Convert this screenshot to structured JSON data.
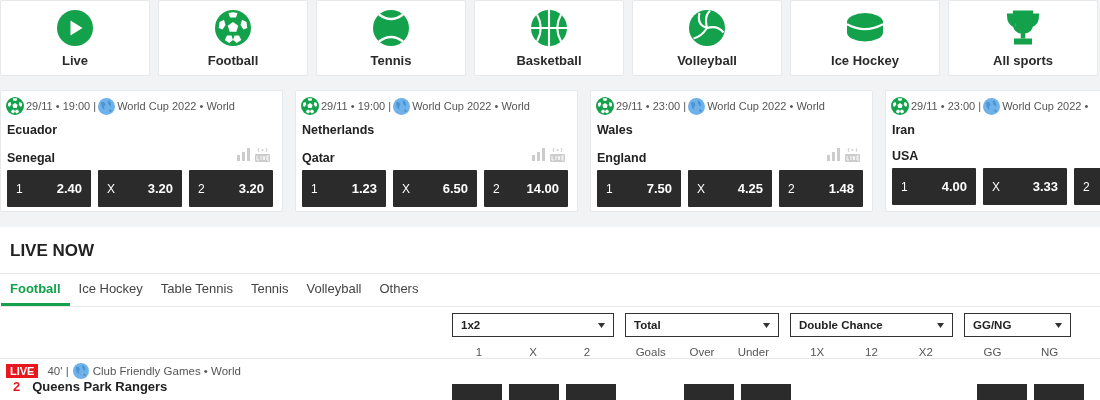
{
  "sports": [
    {
      "label": "Live",
      "kind": "live"
    },
    {
      "label": "Football",
      "kind": "football"
    },
    {
      "label": "Tennis",
      "kind": "tennis"
    },
    {
      "label": "Basketball",
      "kind": "basketball"
    },
    {
      "label": "Volleyball",
      "kind": "volleyball"
    },
    {
      "label": "Ice Hockey",
      "kind": "hockey"
    },
    {
      "label": "All sports",
      "kind": "trophy"
    }
  ],
  "matches": [
    {
      "kind": "football",
      "datetime": "29/11 • 19:00 |",
      "league": "World Cup 2022 • World",
      "home": "Ecuador",
      "away": "Senegal",
      "stats": true,
      "odds": [
        {
          "label": "1",
          "value": "2.40"
        },
        {
          "label": "X",
          "value": "3.20"
        },
        {
          "label": "2",
          "value": "3.20"
        }
      ]
    },
    {
      "kind": "football",
      "datetime": "29/11 • 19:00 |",
      "league": "World Cup 2022 • World",
      "home": "Netherlands",
      "away": "Qatar",
      "stats": true,
      "odds": [
        {
          "label": "1",
          "value": "1.23"
        },
        {
          "label": "X",
          "value": "6.50"
        },
        {
          "label": "2",
          "value": "14.00"
        }
      ]
    },
    {
      "kind": "football",
      "datetime": "29/11 • 23:00 |",
      "league": "World Cup 2022 • World",
      "home": "Wales",
      "away": "England",
      "stats": true,
      "odds": [
        {
          "label": "1",
          "value": "7.50"
        },
        {
          "label": "X",
          "value": "4.25"
        },
        {
          "label": "2",
          "value": "1.48"
        }
      ]
    },
    {
      "kind": "football",
      "datetime": "29/11 • 23:00 |",
      "league": "World Cup 2022 •",
      "home": "Iran",
      "away": "USA",
      "stats": false,
      "odds": [
        {
          "label": "1",
          "value": "4.00"
        },
        {
          "label": "X",
          "value": "3.33"
        },
        {
          "label": "2"
        }
      ]
    }
  ],
  "live": {
    "title": "LIVE NOW",
    "tabs": [
      {
        "label": "Football",
        "selected": true
      },
      {
        "label": "Ice Hockey",
        "selected": false
      },
      {
        "label": "Table Tennis",
        "selected": false
      },
      {
        "label": "Tennis",
        "selected": false
      },
      {
        "label": "Volleyball",
        "selected": false
      },
      {
        "label": "Others",
        "selected": false
      }
    ],
    "markets": [
      {
        "name": "1x2",
        "columns": [
          "1",
          "X",
          "2"
        ]
      },
      {
        "name": "Total",
        "columns": [
          "Goals",
          "Over",
          "Under"
        ]
      },
      {
        "name": "Double Chance",
        "columns": [
          "1X",
          "12",
          "X2"
        ]
      },
      {
        "name": "GG/NG",
        "columns": [
          "GG",
          "NG"
        ]
      }
    ],
    "events": [
      {
        "badge": "LIVE",
        "minute": "40' |",
        "league": "Club Friendly Games • World",
        "score": "2",
        "team": "Queens Park Rangers",
        "slots": [
          {
            "available": true
          },
          {
            "available": true
          },
          {
            "available": true
          },
          {
            "available": false
          },
          {
            "available": true
          },
          {
            "available": true
          },
          {
            "available": false
          },
          {
            "available": false
          },
          {
            "available": false
          },
          {
            "available": true
          },
          {
            "available": true
          }
        ]
      }
    ]
  }
}
